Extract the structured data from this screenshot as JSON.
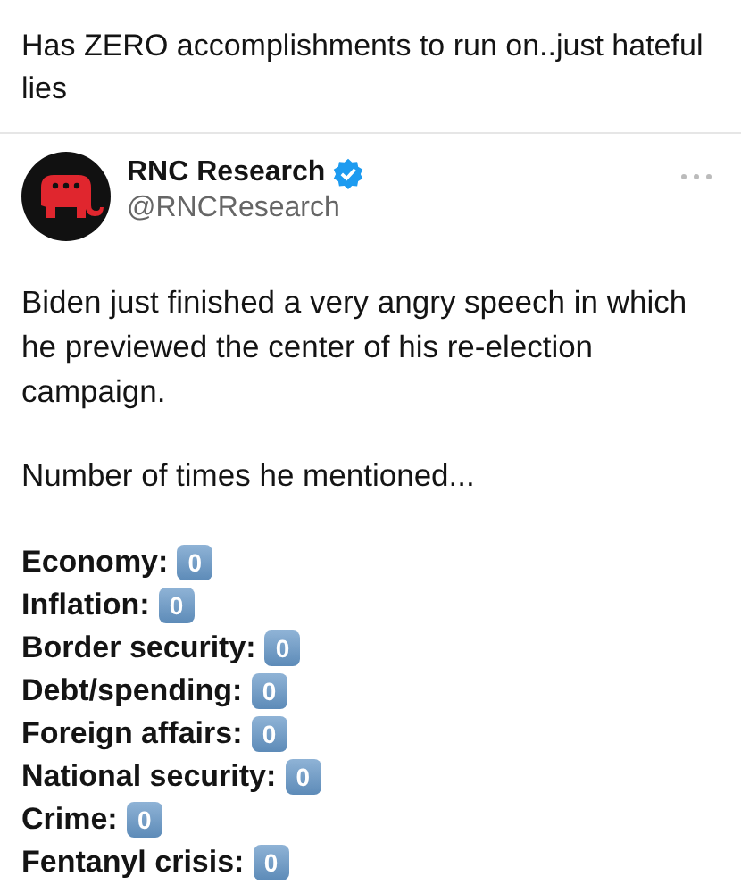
{
  "quote_text": "Has ZERO accomplishments to run on..just hateful lies",
  "post": {
    "author": "RNC Research",
    "verified": true,
    "handle": "@RNCResearch",
    "paragraphs": [
      "Biden just finished a very angry speech in which he previewed the center of his re-election campaign.",
      "Number of times he mentioned..."
    ],
    "tally": [
      {
        "label": "Economy:",
        "count": "0"
      },
      {
        "label": "Inflation:",
        "count": "0"
      },
      {
        "label": "Border security:",
        "count": "0"
      },
      {
        "label": "Debt/spending:",
        "count": "0"
      },
      {
        "label": "Foreign affairs:",
        "count": "0"
      },
      {
        "label": "National security:",
        "count": "0"
      },
      {
        "label": "Crime:",
        "count": "0"
      },
      {
        "label": "Fentanyl crisis:",
        "count": "0"
      }
    ]
  }
}
